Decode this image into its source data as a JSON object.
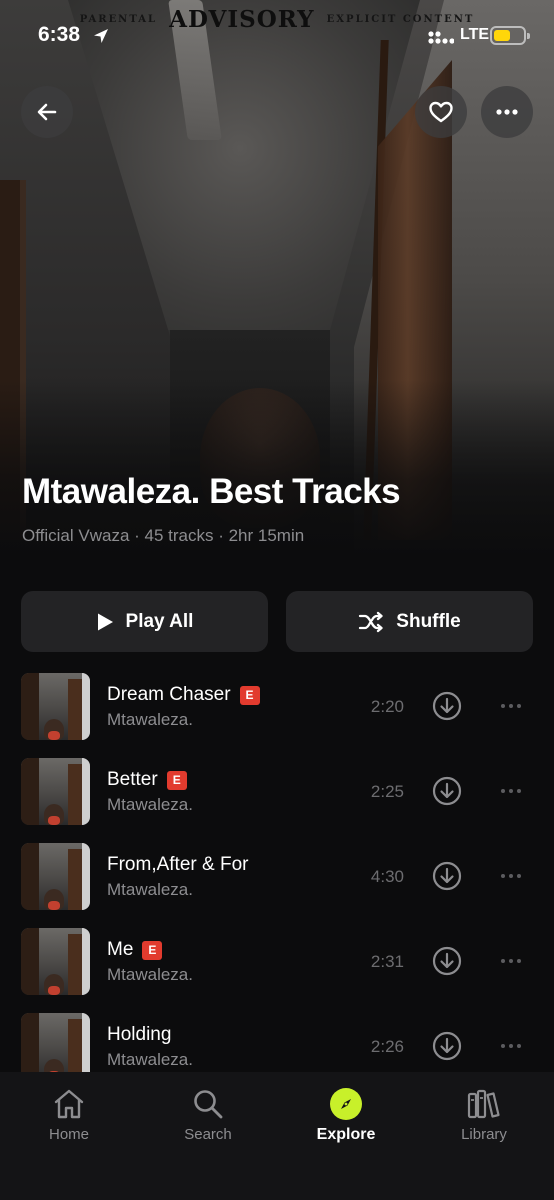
{
  "status_bar": {
    "time": "6:38",
    "network": "LTE",
    "battery_color": "#ffd60a",
    "icons": [
      "location-arrow-icon",
      "signal-dots-icon",
      "battery-icon"
    ]
  },
  "artwork": {
    "advisory_left": "PARENTAL",
    "advisory_main": "ADVISORY",
    "advisory_right": "EXPLICIT CONTENT"
  },
  "header": {
    "back_icon": "arrow-left-icon",
    "like_icon": "heart-icon",
    "more_icon": "more-horizontal-icon"
  },
  "playlist": {
    "title": "Mtawaleza. Best Tracks",
    "meta": "Official Vwaza · 45 tracks · 2hr 15min"
  },
  "actions": {
    "play_all": "Play All",
    "shuffle": "Shuffle"
  },
  "tracks": [
    {
      "title": "Dream Chaser",
      "explicit": true,
      "artist": "Mtawaleza.",
      "duration": "2:20"
    },
    {
      "title": "Better",
      "explicit": true,
      "artist": "Mtawaleza.",
      "duration": "2:25"
    },
    {
      "title": "From,After & For",
      "explicit": false,
      "artist": "Mtawaleza.",
      "duration": "4:30"
    },
    {
      "title": "Me",
      "explicit": true,
      "artist": "Mtawaleza.",
      "duration": "2:31"
    },
    {
      "title": "Holding",
      "explicit": false,
      "artist": "Mtawaleza.",
      "duration": "2:26"
    }
  ],
  "explicit_badge": "E",
  "tab_bar": {
    "tabs": [
      {
        "label": "Home",
        "icon": "home-icon",
        "active": false
      },
      {
        "label": "Search",
        "icon": "search-icon",
        "active": false
      },
      {
        "label": "Explore",
        "icon": "compass-icon",
        "active": true
      },
      {
        "label": "Library",
        "icon": "library-icon",
        "active": false
      }
    ],
    "accent_color": "#c8f02a"
  }
}
